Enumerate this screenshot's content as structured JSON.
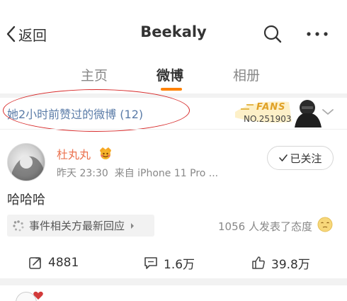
{
  "header": {
    "back_label": "返回",
    "title": "Beekaly",
    "icons": {
      "back": "chevron-left-icon",
      "search": "search-icon",
      "more": "more-icon"
    }
  },
  "tabs": [
    {
      "label": "主页",
      "active": false
    },
    {
      "label": "微博",
      "active": true
    },
    {
      "label": "相册",
      "active": false
    }
  ],
  "accent_color": "#ff8200",
  "liked_bar": {
    "text": "她2小时前赞过的微博 (12)",
    "fans_label": "FANS",
    "fans_no": "NO.251903"
  },
  "post": {
    "username": "杜丸丸",
    "username_color": "#eb7350",
    "time": "昨天 23:30",
    "source": "来自 iPhone 11 Pro ...",
    "follow_label": "已关注",
    "content": "哈哈哈",
    "topic_label": "事件相关方最新回应",
    "reaction_text": "1056 人发表了态度",
    "actions": {
      "reposts": "4881",
      "comments": "1.6万",
      "likes": "39.8万"
    }
  }
}
